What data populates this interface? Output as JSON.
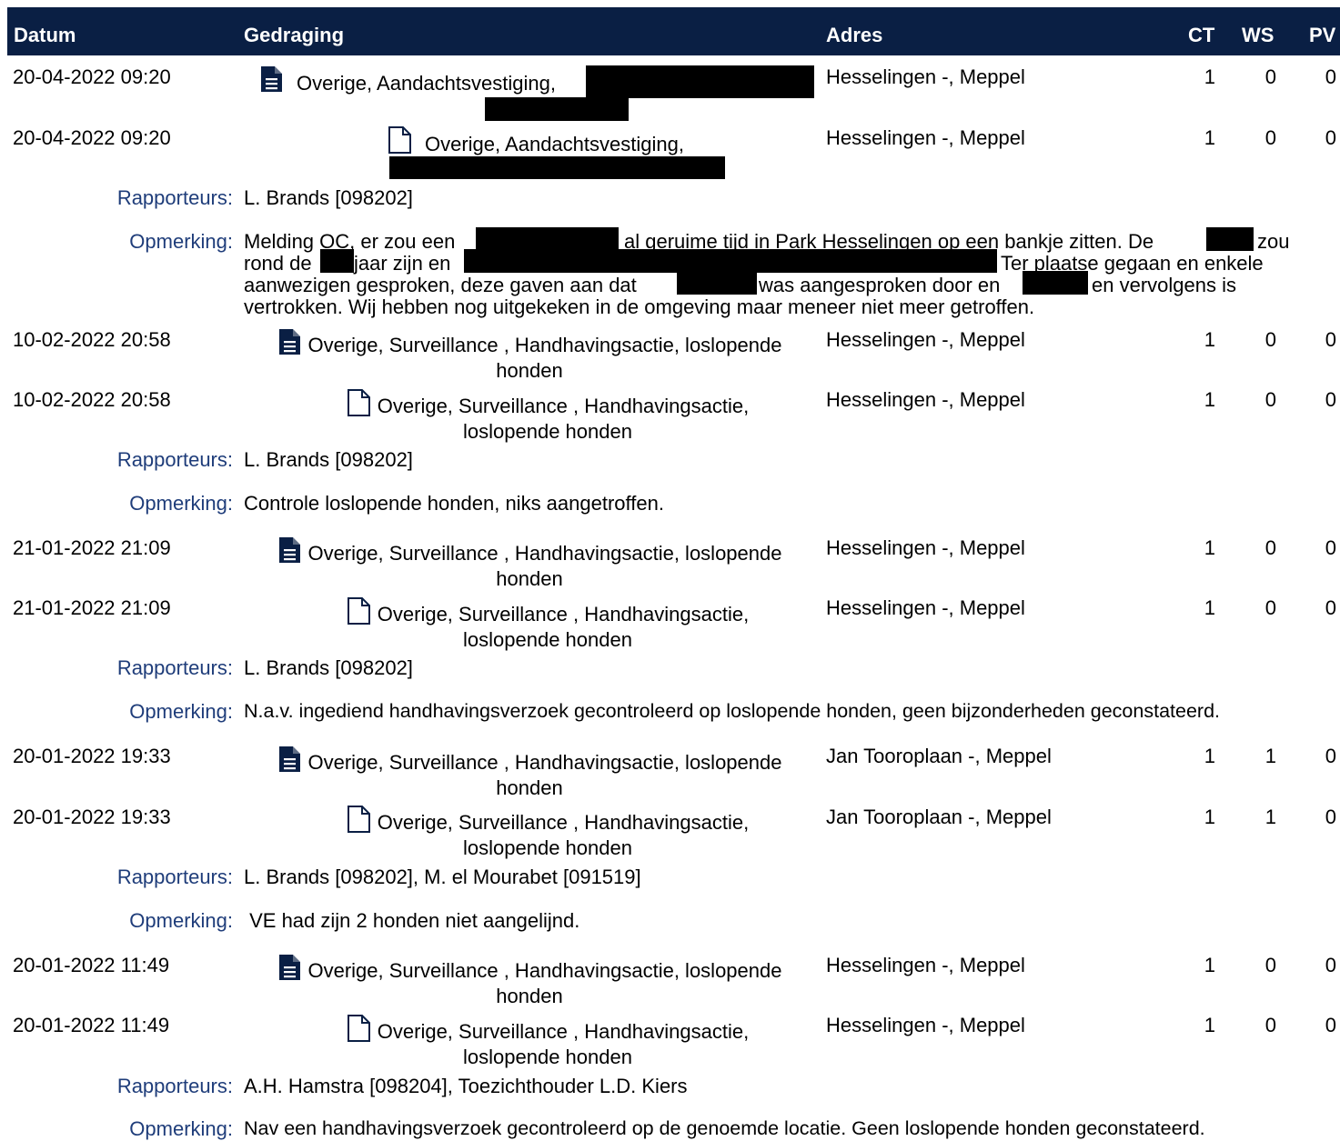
{
  "header": {
    "col_datum": "Datum",
    "col_gedraging": "Gedraging",
    "col_adres": "Adres",
    "col_ct": "CT",
    "col_ws": "WS",
    "col_pv": "PV"
  },
  "labels": {
    "rapporteurs": "Rapporteurs:",
    "opmerking": "Opmerking:"
  },
  "icons": {
    "filled": "document-filled-icon",
    "outline": "document-outline-icon"
  },
  "colors": {
    "header_bg": "#0a1f44",
    "label_text": "#1f3d7a",
    "redaction": "#000000"
  },
  "groups": [
    {
      "rows": [
        {
          "datum": "20-04-2022 09:20",
          "gedraging": "Overige, Aandachtsvestiging,",
          "adres": "Hesselingen -, Meppel",
          "ct": "1",
          "ws": "0",
          "pv": "0"
        },
        {
          "datum": "20-04-2022 09:20",
          "gedraging": "Overige, Aandachtsvestiging,",
          "adres": "Hesselingen -, Meppel",
          "ct": "1",
          "ws": "0",
          "pv": "0"
        }
      ],
      "rapporteurs": "L.  Brands [098202]",
      "opmerking_lines": [
        {
          "parts": [
            "Melding OC, er zou een",
            "al geruime tijd in Park Hesselingen op een bankje zitten. De",
            "zou"
          ]
        },
        {
          "parts": [
            "rond de",
            "jaar zijn en",
            "Ter plaatse gegaan en enkele"
          ]
        },
        {
          "parts": [
            "aanwezigen gesproken, deze gaven aan dat",
            "was aangesproken door en",
            "en vervolgens is"
          ]
        },
        {
          "parts": [
            "vertrokken. Wij hebben nog uitgekeken in de omgeving maar meneer niet meer getroffen."
          ]
        }
      ]
    },
    {
      "rows": [
        {
          "datum": "10-02-2022 20:58",
          "gedraging_line1": "Overige, Surveillance , Handhavingsactie, loslopende",
          "gedraging_line2": "honden",
          "adres": "Hesselingen -, Meppel",
          "ct": "1",
          "ws": "0",
          "pv": "0"
        },
        {
          "datum": "10-02-2022 20:58",
          "gedraging_line1": "Overige, Surveillance , Handhavingsactie,",
          "gedraging_line2": "loslopende honden",
          "adres": "Hesselingen -, Meppel",
          "ct": "1",
          "ws": "0",
          "pv": "0"
        }
      ],
      "rapporteurs": "L.  Brands [098202]",
      "opmerking": "Controle loslopende honden, niks aangetroffen."
    },
    {
      "rows": [
        {
          "datum": "21-01-2022 21:09",
          "gedraging_line1": "Overige, Surveillance , Handhavingsactie, loslopende",
          "gedraging_line2": "honden",
          "adres": "Hesselingen -, Meppel",
          "ct": "1",
          "ws": "0",
          "pv": "0"
        },
        {
          "datum": "21-01-2022 21:09",
          "gedraging_line1": "Overige, Surveillance , Handhavingsactie,",
          "gedraging_line2": "loslopende honden",
          "adres": "Hesselingen -, Meppel",
          "ct": "1",
          "ws": "0",
          "pv": "0"
        }
      ],
      "rapporteurs": "L.  Brands [098202]",
      "opmerking": "N.a.v. ingediend handhavingsverzoek gecontroleerd op loslopende honden, geen bijzonderheden geconstateerd."
    },
    {
      "rows": [
        {
          "datum": "20-01-2022 19:33",
          "gedraging_line1": "Overige, Surveillance , Handhavingsactie, loslopende",
          "gedraging_line2": "honden",
          "adres": "Jan Tooroplaan -, Meppel",
          "ct": "1",
          "ws": "1",
          "pv": "0"
        },
        {
          "datum": "20-01-2022 19:33",
          "gedraging_line1": "Overige, Surveillance , Handhavingsactie,",
          "gedraging_line2": "loslopende honden",
          "adres": "Jan Tooroplaan -, Meppel",
          "ct": "1",
          "ws": "1",
          "pv": "0"
        }
      ],
      "rapporteurs": "L.  Brands [098202], M. el  Mourabet [091519]",
      "opmerking": " VE had zijn 2 honden niet aangelijnd."
    },
    {
      "rows": [
        {
          "datum": "20-01-2022 11:49",
          "gedraging_line1": "Overige, Surveillance , Handhavingsactie, loslopende",
          "gedraging_line2": "honden",
          "adres": "Hesselingen -, Meppel",
          "ct": "1",
          "ws": "0",
          "pv": "0"
        },
        {
          "datum": "20-01-2022 11:49",
          "gedraging_line1": "Overige, Surveillance , Handhavingsactie,",
          "gedraging_line2": "loslopende honden",
          "adres": "Hesselingen -, Meppel",
          "ct": "1",
          "ws": "0",
          "pv": "0"
        }
      ],
      "rapporteurs": "A.H.  Hamstra [098204], Toezichthouder L.D. Kiers",
      "opmerking": "Nav een handhavingsverzoek gecontroleerd op de genoemde locatie. Geen loslopende honden geconstateerd."
    }
  ]
}
